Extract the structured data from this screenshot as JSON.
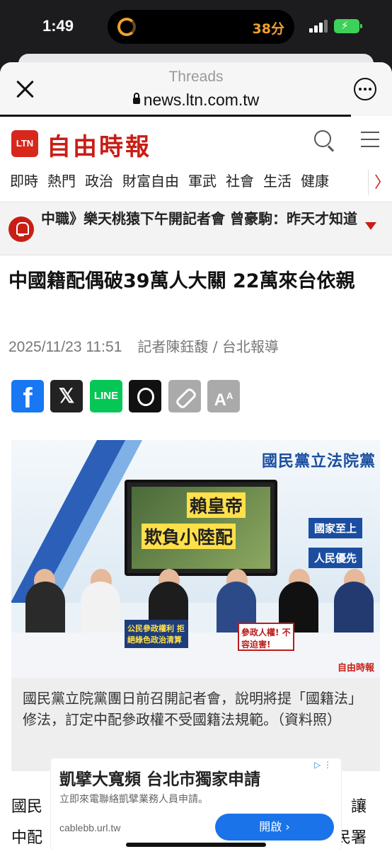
{
  "status_bar": {
    "time": "1:49",
    "timer_label": "38分"
  },
  "browser": {
    "title": "Threads",
    "url": "news.ltn.com.tw"
  },
  "site": {
    "logo_badge": "LTN",
    "logo_name": "自由時報",
    "nav": [
      "即時",
      "熱門",
      "政治",
      "財富自由",
      "軍武",
      "社會",
      "生活",
      "健康"
    ],
    "nav_more": "〉"
  },
  "ticker": {
    "text": "中職》樂天桃猿下午開記者會 曾豪駒：昨天才知道"
  },
  "article": {
    "headline": "中國籍配偶破39萬人大關 22萬來台依親",
    "date": "2025/11/23 11:51",
    "author": "記者陳鈺馥 / 台北報導",
    "share": {
      "fb": "f",
      "x": "𝕏",
      "line": "LINE",
      "font": "A"
    },
    "photo": {
      "banner": "國民黨立法院黨",
      "tv_line1": "賴皇帝",
      "tv_line2": "欺負小陸配",
      "tag1": "國家至上",
      "tag2": "人民優先",
      "sign1": "公民參政權利 拒絕綠色政治清算",
      "sign2": "參政人權! 不容迫害!",
      "watermark": "自由時報"
    },
    "caption": "國民黨立院黨團日前召開記者會，說明將提「國籍法」修法，訂定中配參政權不受國籍法規範。（資料照）",
    "body_line1_left": "國民",
    "body_line1_right": "，讓",
    "body_line2_left": "中配",
    "body_line2_right": "民署"
  },
  "ad": {
    "title": "凱擘大寬頻 台北市獨家申請",
    "subtitle": "立即來電聯絡凱擘業務人員申請。",
    "url": "cablebb.url.tw",
    "button": "開啟 ›",
    "choice": "▷ ⋮"
  }
}
